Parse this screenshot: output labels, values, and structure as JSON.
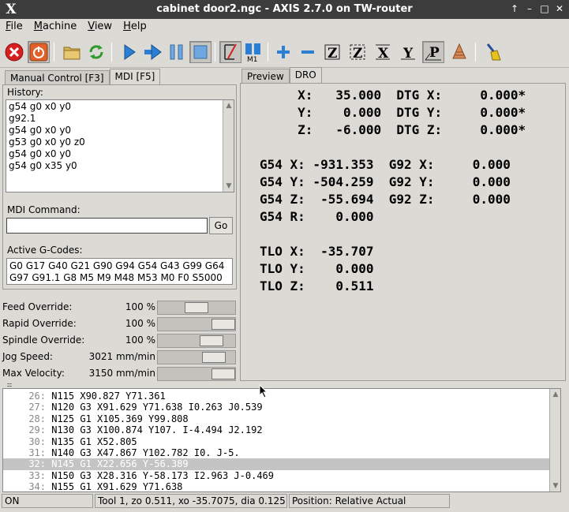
{
  "window": {
    "title": "cabinet door2.ngc - AXIS 2.7.0 on TW-router",
    "logo": "X",
    "controls": [
      "↑",
      "–",
      "□",
      "✕"
    ]
  },
  "menu": [
    {
      "accel": "F",
      "rest": "ile"
    },
    {
      "accel": "M",
      "rest": "achine"
    },
    {
      "accel": "V",
      "rest": "iew"
    },
    {
      "accel": "H",
      "rest": "elp"
    }
  ],
  "toolbar": {
    "icons": [
      "estop-icon",
      "machine-power-icon",
      "open-file-icon",
      "reload-icon",
      "run-icon",
      "step-icon",
      "pause-icon",
      "stop-icon",
      "optional-block-delete-icon",
      "optional-stop-icon",
      "zoom-in-icon",
      "zoom-out-icon",
      "view-z-icon",
      "view-z2-icon",
      "view-x-icon",
      "view-y-icon",
      "view-p-icon",
      "rotate-view-icon",
      "clear-plot-icon"
    ],
    "view_labels": {
      "z": "Z",
      "z2": "Z",
      "x": "X",
      "y": "Y",
      "p": "P",
      "m1": "M1"
    }
  },
  "left_tabs": [
    "Manual Control [F3]",
    "MDI [F5]"
  ],
  "right_tabs": [
    "Preview",
    "DRO"
  ],
  "mdi": {
    "history_label": "History:",
    "history": [
      "g54 g0 x0 y0",
      "g92.1",
      "g54 g0 x0 y0",
      "g53 g0 x0 y0 z0",
      "g54 g0 x0 y0",
      "g54 g0 x35 y0"
    ],
    "command_label": "MDI Command:",
    "command_value": "",
    "go_label": "Go",
    "active_label": "Active G-Codes:",
    "active_codes": [
      "G0 G17 G40 G21 G90 G94 G54 G43 G99 G64",
      "G97 G91.1 G8 M5 M9 M48 M53 M0 F0 S5000"
    ]
  },
  "overrides": [
    {
      "label": "Feed Override:",
      "value": "100 %",
      "level": 0.5
    },
    {
      "label": "Rapid Override:",
      "value": "100 %",
      "level": 1.0
    },
    {
      "label": "Spindle Override:",
      "value": "100 %",
      "level": 0.78
    },
    {
      "label": "Jog Speed:",
      "value": "3021 mm/min",
      "level": 0.82
    },
    {
      "label": "Max Velocity:",
      "value": "3150 mm/min",
      "level": 1.0
    }
  ],
  "dro": [
    "     X:   35.000  DTG X:     0.000*",
    "     Y:    0.000  DTG Y:     0.000*",
    "     Z:   -6.000  DTG Z:     0.000*",
    "",
    "G54 X: -931.353  G92 X:     0.000",
    "G54 Y: -504.259  G92 Y:     0.000",
    "G54 Z:  -55.694  G92 Z:     0.000",
    "G54 R:    0.000",
    "",
    "TLO X:  -35.707",
    "TLO Y:    0.000",
    "TLO Z:    0.511"
  ],
  "gcode": [
    {
      "n": "26:",
      "code": "N115 X90.827 Y71.361",
      "selected": false
    },
    {
      "n": "27:",
      "code": "N120 G3 X91.629 Y71.638 I0.263 J0.539",
      "selected": false
    },
    {
      "n": "28:",
      "code": "N125 G1 X105.369 Y99.808",
      "selected": false
    },
    {
      "n": "29:",
      "code": "N130 G3 X100.874 Y107. I-4.494 J2.192",
      "selected": false
    },
    {
      "n": "30:",
      "code": "N135 G1 X52.805",
      "selected": false
    },
    {
      "n": "31:",
      "code": "N140 G3 X47.867 Y102.782 I0. J-5.",
      "selected": false
    },
    {
      "n": "32:",
      "code": "N145 G1 X22.656 Y-56.389",
      "selected": true
    },
    {
      "n": "33:",
      "code": "N150 G3 X28.316 Y-58.173 I2.963 J-0.469",
      "selected": false
    },
    {
      "n": "34:",
      "code": "N155 G1 X91.629 Y71.638",
      "selected": false
    }
  ],
  "status": {
    "state": "ON",
    "tool": "Tool 1, zo 0.511, xo -35.7075, dia 0.125",
    "position": "Position: Relative Actual"
  },
  "colors": {
    "estop": "#d62020",
    "accent_blue": "#2a7fd4",
    "green": "#2c9b2c",
    "selection": "#c4c4c4"
  }
}
